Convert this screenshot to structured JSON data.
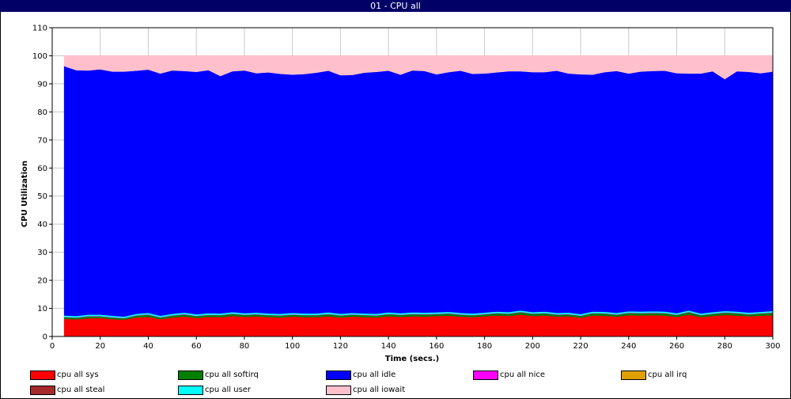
{
  "window": {
    "title": "01  -  CPU all"
  },
  "chart_data": {
    "type": "area",
    "stacked": true,
    "title": "01  -  CPU all",
    "xlabel": "Time (secs.)",
    "ylabel": "CPU Utilization",
    "xlim": [
      0,
      300
    ],
    "ylim": [
      0,
      110
    ],
    "xticks": [
      0,
      20,
      40,
      60,
      80,
      100,
      120,
      140,
      160,
      180,
      200,
      220,
      240,
      260,
      280,
      300
    ],
    "yticks": [
      0,
      10,
      20,
      30,
      40,
      50,
      60,
      70,
      80,
      90,
      100,
      110
    ],
    "grid": true,
    "legend_position": "bottom",
    "x": [
      5,
      10,
      15,
      20,
      25,
      30,
      35,
      40,
      45,
      50,
      55,
      60,
      65,
      70,
      75,
      80,
      85,
      90,
      95,
      100,
      105,
      110,
      115,
      120,
      125,
      130,
      135,
      140,
      145,
      150,
      155,
      160,
      165,
      170,
      175,
      180,
      185,
      190,
      195,
      200,
      205,
      210,
      215,
      220,
      225,
      230,
      235,
      240,
      245,
      250,
      255,
      260,
      265,
      270,
      275,
      280,
      285,
      290,
      295,
      300
    ],
    "stack_order": [
      "cpu all sys",
      "cpu all softirq",
      "cpu all irq",
      "cpu all steal",
      "cpu all nice",
      "cpu all user",
      "cpu all idle",
      "cpu all iowait"
    ],
    "series": [
      {
        "name": "cpu all sys",
        "color": "#ff0000",
        "values": [
          6.3,
          6.1,
          6.5,
          6.6,
          6.2,
          6.0,
          6.8,
          7.0,
          6.2,
          6.8,
          7.1,
          6.6,
          7.0,
          6.9,
          7.3,
          7.0,
          7.2,
          6.9,
          6.8,
          7.1,
          6.9,
          6.9,
          7.2,
          6.8,
          7.1,
          6.9,
          6.8,
          7.2,
          7.0,
          7.2,
          7.1,
          7.3,
          7.4,
          7.1,
          6.9,
          7.2,
          7.5,
          7.3,
          7.8,
          7.3,
          7.5,
          7.1,
          7.2,
          6.7,
          7.5,
          7.4,
          7.1,
          7.6,
          7.5,
          7.6,
          7.5,
          7.0,
          7.8,
          6.9,
          7.3,
          7.7,
          7.5,
          7.2,
          7.4,
          7.6
        ]
      },
      {
        "name": "cpu all softirq",
        "color": "#008000",
        "values": [
          0.7,
          0.7,
          0.8,
          0.7,
          0.7,
          0.6,
          0.8,
          0.9,
          0.7,
          0.8,
          0.9,
          0.8,
          0.8,
          0.8,
          0.9,
          0.8,
          0.8,
          0.8,
          0.8,
          0.8,
          0.8,
          0.8,
          0.9,
          0.8,
          0.8,
          0.8,
          0.8,
          0.9,
          0.8,
          0.9,
          0.9,
          0.8,
          0.9,
          0.8,
          0.8,
          0.8,
          0.9,
          0.9,
          1.0,
          0.9,
          0.9,
          0.8,
          0.8,
          0.8,
          0.9,
          0.9,
          0.8,
          0.9,
          0.9,
          0.9,
          0.9,
          0.8,
          1.0,
          0.8,
          0.9,
          0.9,
          0.9,
          0.8,
          0.9,
          1.0
        ]
      },
      {
        "name": "cpu all irq",
        "color": "#e0a000",
        "values": [
          0,
          0,
          0,
          0,
          0,
          0,
          0,
          0,
          0,
          0,
          0,
          0,
          0,
          0,
          0,
          0,
          0,
          0,
          0,
          0,
          0,
          0,
          0,
          0,
          0,
          0,
          0,
          0,
          0,
          0,
          0,
          0,
          0,
          0,
          0,
          0,
          0,
          0,
          0,
          0,
          0,
          0,
          0,
          0,
          0,
          0,
          0,
          0,
          0,
          0,
          0,
          0,
          0,
          0,
          0,
          0,
          0,
          0,
          0,
          0
        ]
      },
      {
        "name": "cpu all steal",
        "color": "#a52a2a",
        "values": [
          0,
          0,
          0,
          0,
          0,
          0,
          0,
          0,
          0,
          0,
          0,
          0,
          0,
          0,
          0,
          0,
          0,
          0,
          0,
          0,
          0,
          0,
          0,
          0,
          0,
          0,
          0,
          0,
          0,
          0,
          0,
          0,
          0,
          0,
          0,
          0,
          0,
          0,
          0,
          0,
          0,
          0,
          0,
          0,
          0,
          0,
          0,
          0,
          0,
          0,
          0,
          0,
          0,
          0,
          0,
          0,
          0,
          0,
          0,
          0
        ]
      },
      {
        "name": "cpu all nice",
        "color": "#ff00ff",
        "values": [
          0,
          0,
          0,
          0,
          0,
          0,
          0,
          0,
          0,
          0,
          0,
          0,
          0,
          0,
          0,
          0,
          0,
          0,
          0,
          0,
          0,
          0,
          0,
          0,
          0,
          0,
          0,
          0,
          0,
          0,
          0,
          0,
          0,
          0,
          0,
          0,
          0,
          0,
          0,
          0,
          0,
          0,
          0,
          0,
          0,
          0,
          0,
          0,
          0,
          0,
          0,
          0,
          0,
          0,
          0,
          0,
          0,
          0,
          0,
          0
        ]
      },
      {
        "name": "cpu all user",
        "color": "#00ffff",
        "values": [
          0.5,
          0.5,
          0.5,
          0.5,
          0.5,
          0.5,
          0.5,
          0.5,
          0.5,
          0.5,
          0.5,
          0.5,
          0.5,
          0.5,
          0.5,
          0.5,
          0.5,
          0.5,
          0.5,
          0.5,
          0.5,
          0.5,
          0.5,
          0.5,
          0.5,
          0.5,
          0.5,
          0.5,
          0.5,
          0.5,
          0.5,
          0.5,
          0.5,
          0.5,
          0.5,
          0.5,
          0.5,
          0.5,
          0.5,
          0.5,
          0.5,
          0.5,
          0.5,
          0.5,
          0.5,
          0.5,
          0.5,
          0.5,
          0.5,
          0.5,
          0.5,
          0.5,
          0.5,
          0.5,
          0.5,
          0.5,
          0.5,
          0.5,
          0.5,
          0.5
        ]
      },
      {
        "name": "cpu all idle",
        "color": "#0000ff",
        "values": [
          88.8,
          87.6,
          87.0,
          87.4,
          87.0,
          87.3,
          86.6,
          86.7,
          86.3,
          86.7,
          86.1,
          86.4,
          86.6,
          84.6,
          85.8,
          86.5,
          85.3,
          85.9,
          85.5,
          84.9,
          85.3,
          85.8,
          86.1,
          85.0,
          84.8,
          85.8,
          86.2,
          86.1,
          85.0,
          86.2,
          86.1,
          84.8,
          85.4,
          86.3,
          85.4,
          85.2,
          85.2,
          85.8,
          85.2,
          85.5,
          85.3,
          86.3,
          85.2,
          85.4,
          84.4,
          85.4,
          86.2,
          84.7,
          85.5,
          85.6,
          85.8,
          85.5,
          84.4,
          85.5,
          85.8,
          82.6,
          85.6,
          85.8,
          85.0,
          85.3
        ]
      },
      {
        "name": "cpu all iowait",
        "color": "#ffc0cb",
        "values": [
          3.7,
          5.1,
          5.2,
          4.8,
          5.6,
          5.6,
          5.3,
          4.9,
          6.3,
          5.2,
          5.4,
          5.7,
          5.1,
          7.2,
          5.5,
          5.2,
          6.2,
          5.9,
          6.4,
          6.7,
          6.5,
          6.0,
          5.3,
          6.9,
          6.8,
          6.0,
          5.7,
          5.3,
          6.7,
          5.2,
          5.4,
          6.6,
          5.8,
          5.3,
          6.4,
          6.3,
          5.9,
          5.5,
          5.5,
          5.8,
          5.8,
          5.3,
          6.3,
          6.6,
          6.7,
          5.8,
          5.4,
          6.3,
          5.6,
          5.4,
          5.3,
          6.2,
          6.3,
          6.3,
          5.5,
          8.3,
          5.5,
          5.7,
          6.2,
          5.6
        ]
      }
    ]
  },
  "legend": {
    "items": [
      {
        "label": "cpu all sys",
        "color": "#ff0000"
      },
      {
        "label": "cpu all softirq",
        "color": "#008000"
      },
      {
        "label": "cpu all idle",
        "color": "#0000ff"
      },
      {
        "label": "cpu all nice",
        "color": "#ff00ff"
      },
      {
        "label": "cpu all irq",
        "color": "#e0a000"
      },
      {
        "label": "cpu all steal",
        "color": "#a52a2a"
      },
      {
        "label": "cpu all user",
        "color": "#00ffff"
      },
      {
        "label": "cpu all iowait",
        "color": "#ffc0cb"
      }
    ]
  }
}
